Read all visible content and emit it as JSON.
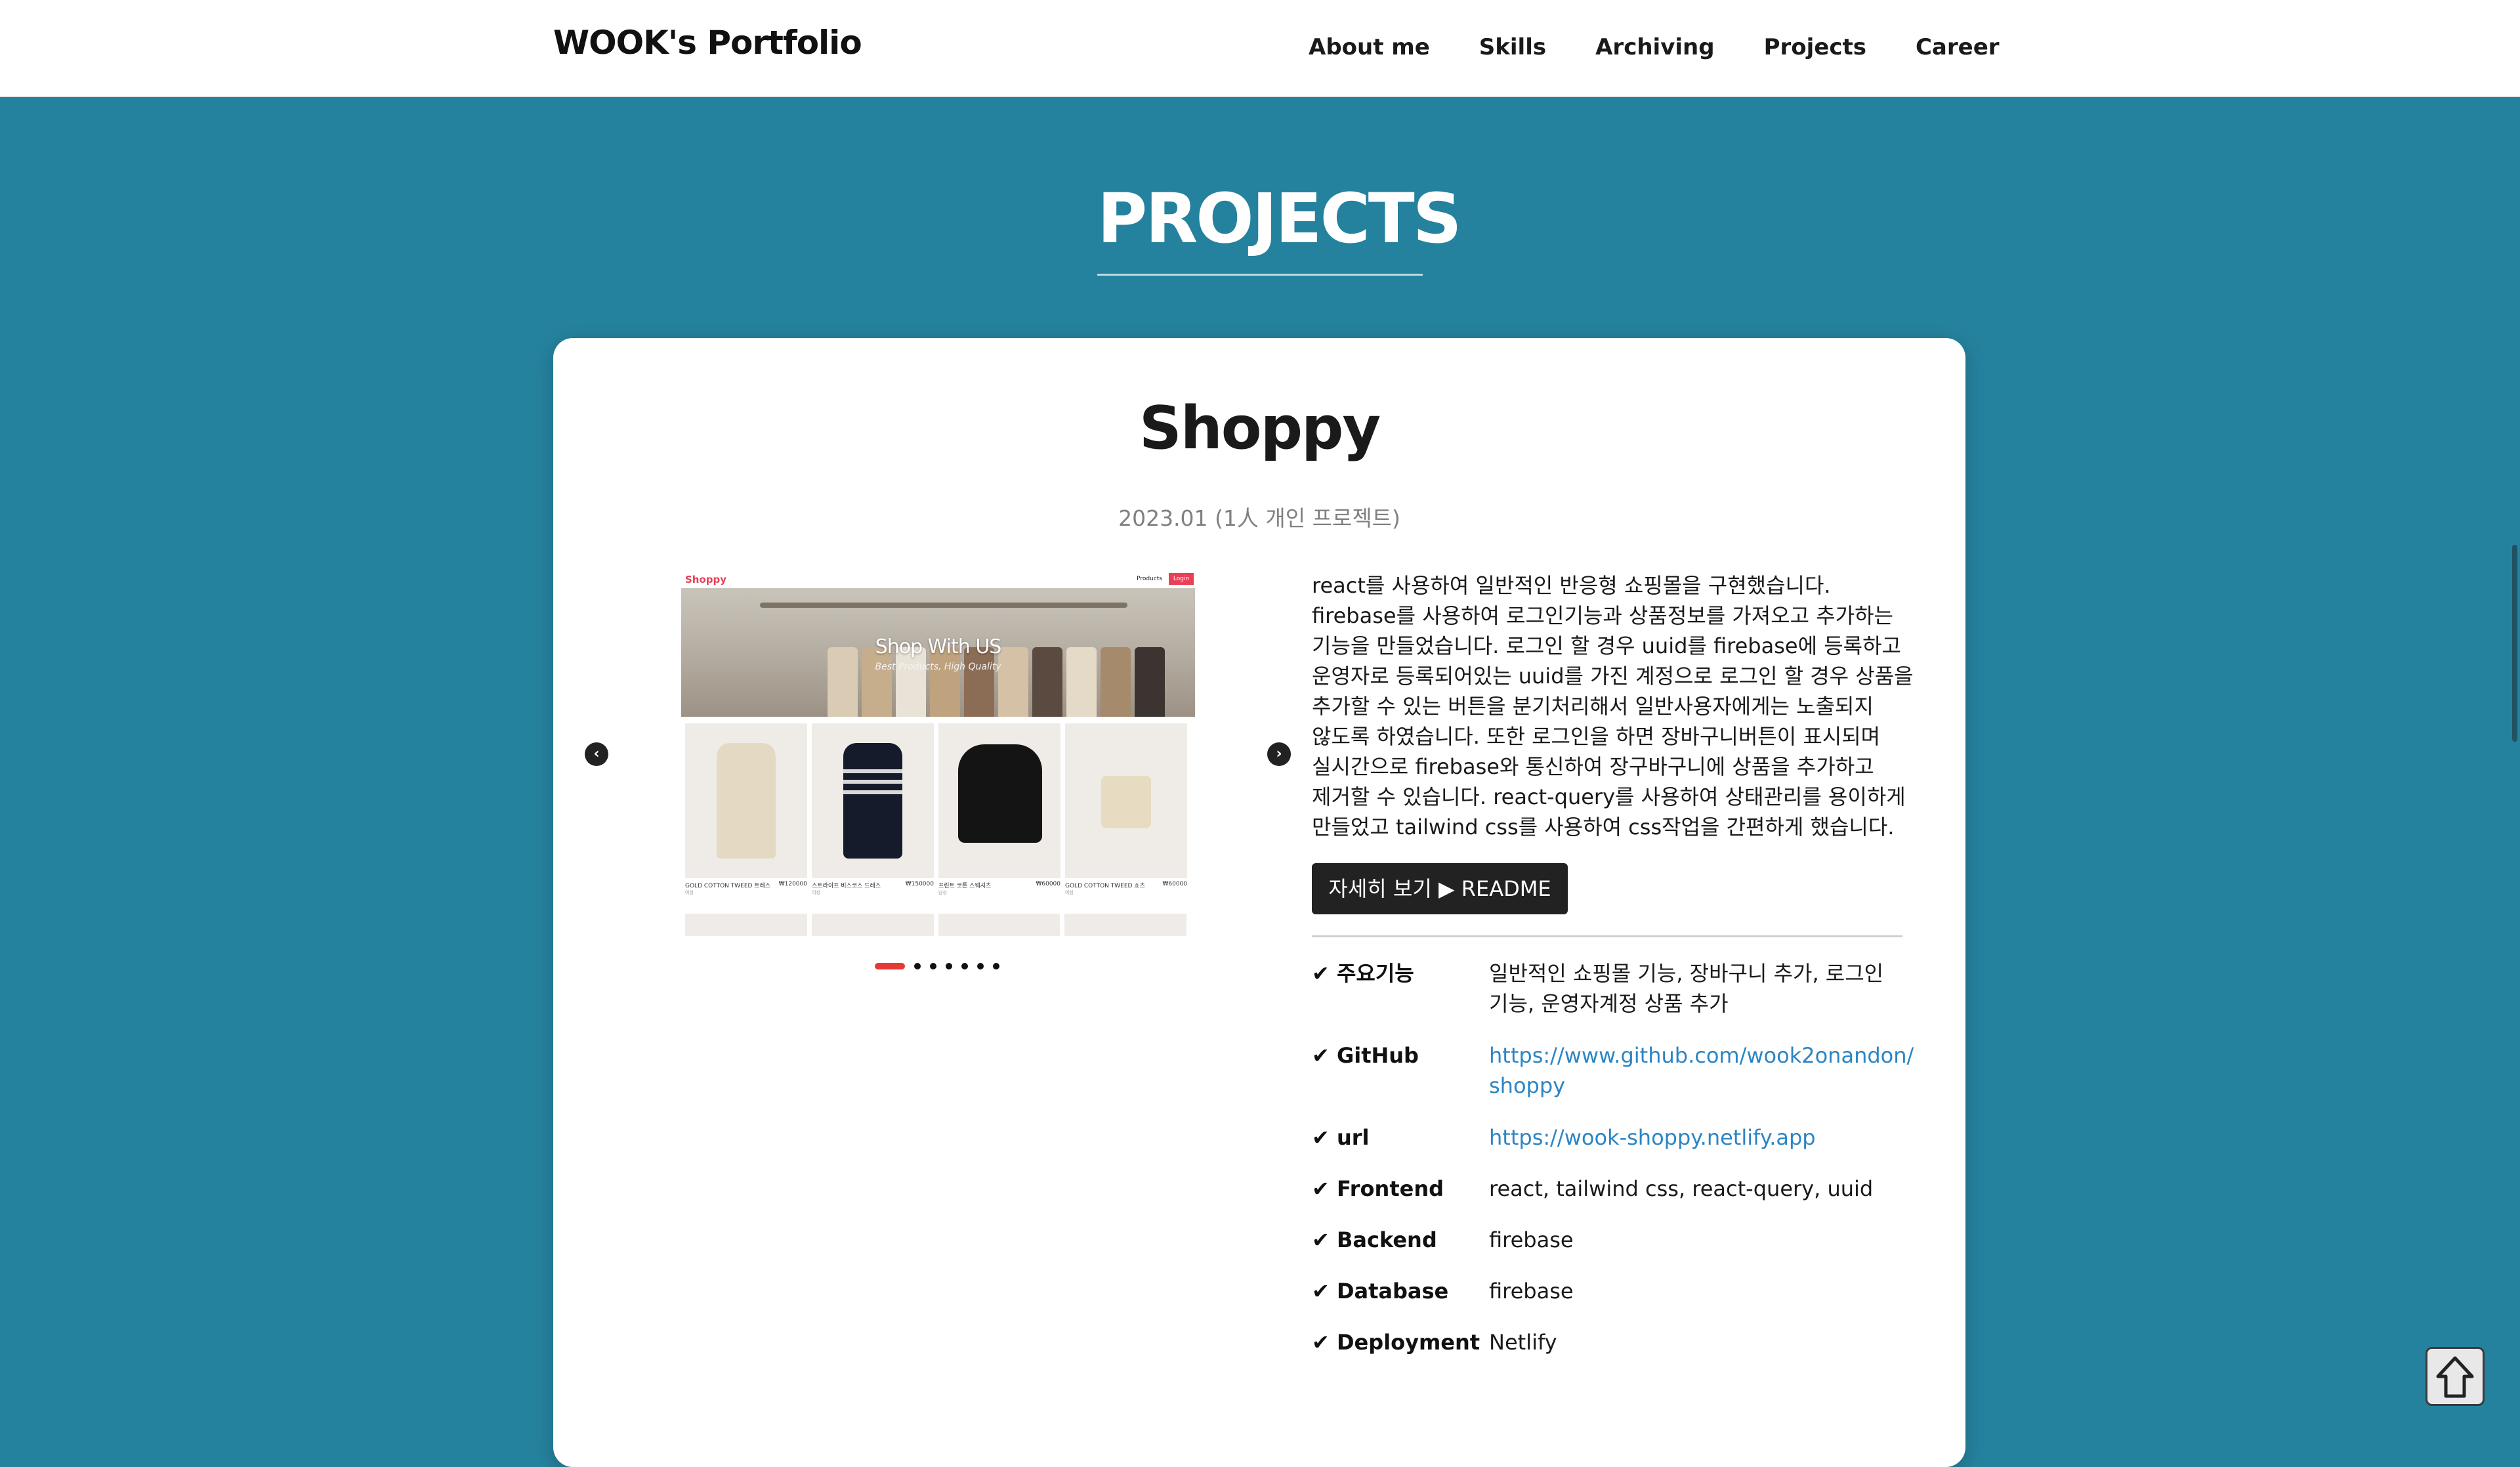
{
  "nav": {
    "brand": "WOOK's Portfolio",
    "links": [
      "About me",
      "Skills",
      "Archiving",
      "Projects",
      "Career"
    ]
  },
  "section": {
    "title": "PROJECTS"
  },
  "project": {
    "title": "Shoppy",
    "date": "2023.01 (1人 개인 프로젝트)",
    "description": [
      "react를 사용하여 일반적인 반응형 쇼핑몰을 구현했습니다.",
      "firebase를 사용하여 로그인기능과 상품정보를 가져오고 추가하는",
      "기능을 만들었습니다. 로그인 할 경우 uuid를 firebase에 등록하고",
      "운영자로 등록되어있는 uuid를 가진 계정으로 로그인 할 경우 상품을",
      "추가할 수 있는 버튼을 분기처리해서 일반사용자에게는 노출되지",
      "않도록 하였습니다. 또한 로그인을 하면 장바구니버튼이 표시되며",
      "실시간으로 firebase와 통신하여 장구바구니에 상품을 추가하고",
      "제거할 수 있습니다. react-query를 사용하여 상태관리를 용이하게",
      "만들었고 tailwind css를 사용하여 css작업을 간편하게 했습니다."
    ],
    "readme_button": "자세히 보기 ▶ README",
    "check_icon": "✔",
    "info": [
      {
        "label": "주요기능",
        "value": [
          "일반적인 쇼핑몰 기능, 장바구니 추가, 로그인",
          "기능, 운영자계정 상품 추가"
        ]
      },
      {
        "label": "GitHub",
        "value": [
          "https://www.github.com/wook2onandon/",
          "shoppy"
        ]
      },
      {
        "label": "url",
        "value": [
          "https://wook-shoppy.netlify.app"
        ]
      },
      {
        "label": "Frontend",
        "value": [
          "react, tailwind css, react-query, uuid"
        ]
      },
      {
        "label": "Backend",
        "value": [
          "firebase"
        ]
      },
      {
        "label": "Database",
        "value": [
          "firebase"
        ]
      },
      {
        "label": "Deployment",
        "value": [
          "Netlify"
        ]
      }
    ],
    "carousel": {
      "prev_icon": "chevron-left-icon",
      "next_icon": "chevron-right-icon",
      "slide_count": 8,
      "active_slide": 1
    },
    "screenshot": {
      "logo": "Shoppy",
      "nav_products": "Products",
      "nav_login": "Login",
      "banner_title": "Shop With US",
      "banner_subtitle": "Best Products, High Quality",
      "products": [
        {
          "name": "GOLD COTTON TWEED 트레스",
          "price": "₩120000",
          "category": "여성"
        },
        {
          "name": "스트라이프 비스코스 드레스",
          "price": "₩150000",
          "category": "여성"
        },
        {
          "name": "프린트 코튼 스웨셔츠",
          "price": "₩60000",
          "category": "남성"
        },
        {
          "name": "GOLD COTTON TWEED 쇼츠",
          "price": "₩60000",
          "category": "여성"
        }
      ]
    }
  },
  "colors": {
    "background": "#25829e",
    "accent": "#e53935",
    "link": "#2b85c4"
  },
  "scroll_top_icon": "arrow-up-icon"
}
